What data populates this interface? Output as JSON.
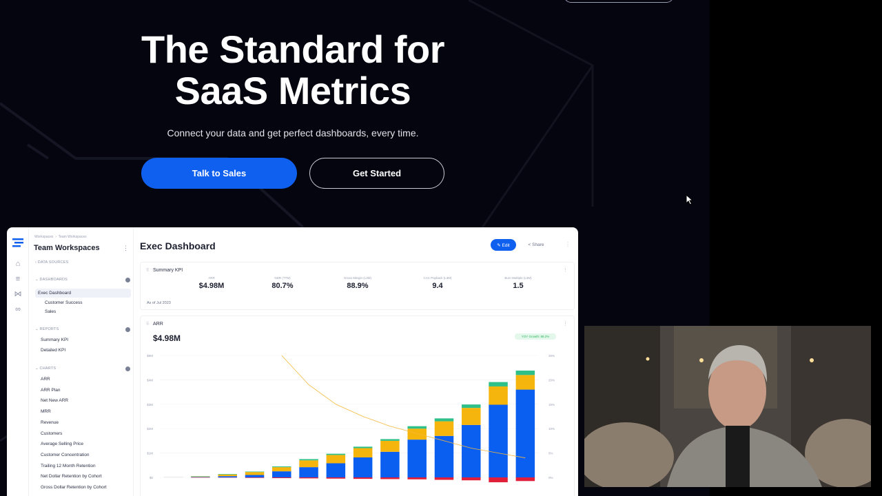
{
  "hero": {
    "headline_line1": "The Standard for",
    "headline_line2": "SaaS Metrics",
    "subhead": "Connect your data and get perfect dashboards, every time.",
    "cta_primary": "Talk to Sales",
    "cta_secondary": "Get Started"
  },
  "dashboard": {
    "breadcrumb": [
      "Workspaces",
      "Team Workspaces"
    ],
    "workspace_title": "Team Workspaces",
    "sidebar": {
      "data_sources": "DATA SOURCES",
      "dashboards_section": "DASHBOARDS",
      "dashboards": [
        "Exec Dashboard",
        "Customer Success",
        "Sales"
      ],
      "reports_section": "REPORTS",
      "reports": [
        "Summary KPI",
        "Detailed KPI"
      ],
      "charts_section": "CHARTS",
      "charts": [
        "ARR",
        "ARR Plan",
        "Net New ARR",
        "MRR",
        "Revenue",
        "Customers",
        "Average Selling Price",
        "Customer Concentration",
        "Trailing 12 Month Retention",
        "Net Dollar Retention by Cohort",
        "Gross Dollar Retention by Cohort"
      ]
    },
    "title": "Exec Dashboard",
    "edit_label": "✎ Edit",
    "share_label": "< Share",
    "summary": {
      "title": "Summary KPI",
      "as_of": "As of Jul 2023",
      "kpis": [
        {
          "label": "ARR",
          "value": "$4.98M"
        },
        {
          "label": "NDR (TTM)",
          "value": "80.7%"
        },
        {
          "label": "Gross Margin (L3M)",
          "value": "88.9%"
        },
        {
          "label": "CAC Payback (L3M)",
          "value": "9.4"
        },
        {
          "label": "Burn Multiple (L3M)",
          "value": "1.5"
        }
      ]
    },
    "arr_card": {
      "title": "ARR",
      "value": "$4.98M",
      "badge": "YOY Growth: 88.2%"
    }
  },
  "chart_data": {
    "type": "bar",
    "stacked": true,
    "y_ticks_left": [
      "$0",
      "$1M",
      "$2M",
      "$3M",
      "$4M",
      "$5M"
    ],
    "y_ticks_right": [
      "0%",
      "5%",
      "10%",
      "15%",
      "20%",
      "25%"
    ],
    "ylim": [
      0,
      5
    ],
    "series": [
      {
        "color": "#0b5ff0",
        "values": [
          0,
          0.02,
          0.05,
          0.1,
          0.25,
          0.42,
          0.58,
          0.82,
          1.05,
          1.55,
          1.7,
          2.15,
          2.98,
          3.6
        ]
      },
      {
        "color": "#f5b50d",
        "values": [
          0,
          0.02,
          0.07,
          0.12,
          0.17,
          0.28,
          0.34,
          0.38,
          0.45,
          0.45,
          0.6,
          0.7,
          0.75,
          0.6
        ]
      },
      {
        "color": "#2fc08a",
        "values": [
          0,
          0.01,
          0.02,
          0.02,
          0.03,
          0.05,
          0.05,
          0.06,
          0.07,
          0.1,
          0.12,
          0.14,
          0.18,
          0.18
        ]
      },
      {
        "color": "#e0203a",
        "values": [
          0,
          -0.01,
          -0.01,
          -0.02,
          -0.03,
          -0.04,
          -0.05,
          -0.06,
          -0.07,
          -0.08,
          -0.1,
          -0.12,
          -0.2,
          -0.15
        ]
      }
    ],
    "line": {
      "color": "#f5b83a",
      "values": [
        null,
        null,
        null,
        null,
        25,
        19,
        15,
        12.5,
        10.5,
        9,
        7.5,
        6,
        5,
        4
      ]
    },
    "grid": true
  },
  "colors": {
    "accent": "#1060f0",
    "hero_bg": "#05050f",
    "positive": "#2fb563"
  }
}
